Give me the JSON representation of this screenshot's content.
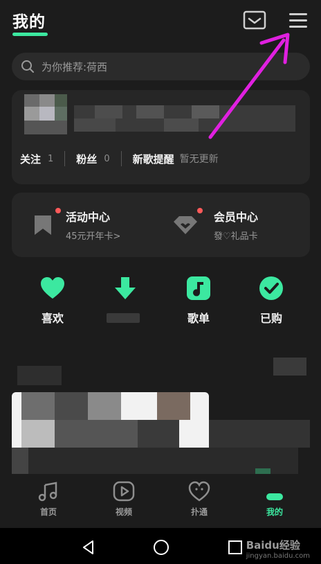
{
  "header": {
    "title": "我的",
    "mail_icon": "mail-icon",
    "menu_icon": "menu-icon"
  },
  "search": {
    "placeholder": "为你推荐:荷西"
  },
  "profile": {
    "follow_label": "关注",
    "follow_count": "1",
    "fans_label": "粉丝",
    "fans_count": "0",
    "new_songs_label": "新歌提醒",
    "new_songs_status": "暂无更新"
  },
  "centers": {
    "activity": {
      "title": "活动中心",
      "subtitle": "45元开年卡>"
    },
    "vip": {
      "title": "会员中心",
      "subtitle": "發♡礼品卡"
    }
  },
  "quick_actions": [
    {
      "label": "喜欢",
      "icon": "heart-icon"
    },
    {
      "label": "",
      "icon": "download-icon"
    },
    {
      "label": "歌单",
      "icon": "music-note-icon"
    },
    {
      "label": "已购",
      "icon": "check-icon"
    }
  ],
  "tabs": [
    {
      "label": "首页",
      "icon": "music-note-icon"
    },
    {
      "label": "视频",
      "icon": "video-icon"
    },
    {
      "label": "扑通",
      "icon": "heart-face-icon"
    },
    {
      "label": "我的",
      "icon": "profile-icon"
    }
  ],
  "watermark": {
    "text": "Baidu经验",
    "url_text": "jingyan.baidu.com"
  },
  "colors": {
    "accent": "#3ce8a0",
    "annotation_arrow": "#e020e0",
    "badge_dot": "#ff5a5a"
  }
}
